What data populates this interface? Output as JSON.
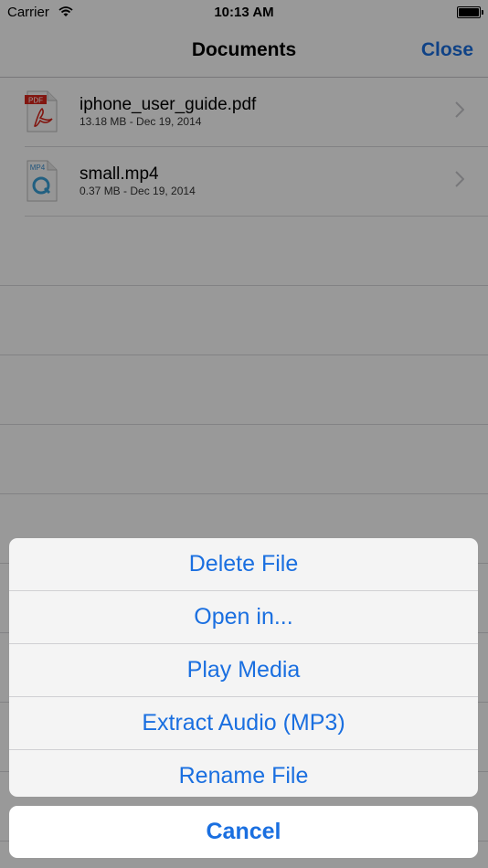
{
  "status_bar": {
    "carrier": "Carrier",
    "time": "10:13 AM"
  },
  "nav": {
    "title": "Documents",
    "close_label": "Close"
  },
  "files": [
    {
      "name": "iphone_user_guide.pdf",
      "meta": "13.18 MB - Dec 19, 2014",
      "icon": "pdf-file-icon",
      "icon_label": "PDF"
    },
    {
      "name": "small.mp4",
      "meta": "0.37 MB - Dec 19, 2014",
      "icon": "mp4-file-icon",
      "icon_label": "MP4"
    }
  ],
  "action_sheet": {
    "items": [
      "Delete File",
      "Open in...",
      "Play Media",
      "Extract Audio (MP3)",
      "Rename File"
    ],
    "cancel_label": "Cancel"
  },
  "colors": {
    "accent": "#1a6fe0",
    "pdf_red": "#d9261c"
  }
}
